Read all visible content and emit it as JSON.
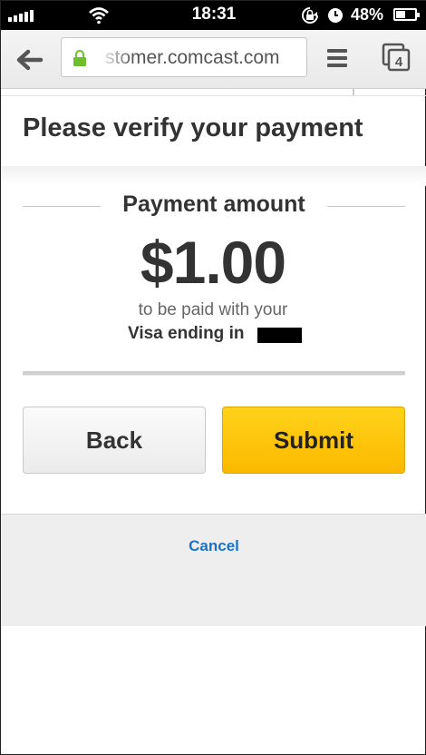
{
  "status_bar": {
    "time": "18:31",
    "battery_percent": "48%",
    "battery_level": 0.48,
    "icons": [
      "signal-icon",
      "wifi-icon",
      "rotation-lock-icon",
      "alarm-icon",
      "battery-icon"
    ]
  },
  "browser": {
    "url_text": "stomer.comcast.com",
    "tab_count": "4",
    "icons": [
      "back-arrow-icon",
      "lock-icon",
      "menu-icon",
      "tabs-icon"
    ]
  },
  "page": {
    "title": "Please verify your payment",
    "amount_heading": "Payment amount",
    "amount_value": "$1.00",
    "paid_with": "to be paid with your",
    "card_label": "Visa ending in"
  },
  "buttons": {
    "back_label": "Back",
    "submit_label": "Submit"
  },
  "footer": {
    "cancel_label": "Cancel"
  },
  "colors": {
    "submit": "#fbc400",
    "link": "#1a73c8",
    "text": "#333333"
  }
}
